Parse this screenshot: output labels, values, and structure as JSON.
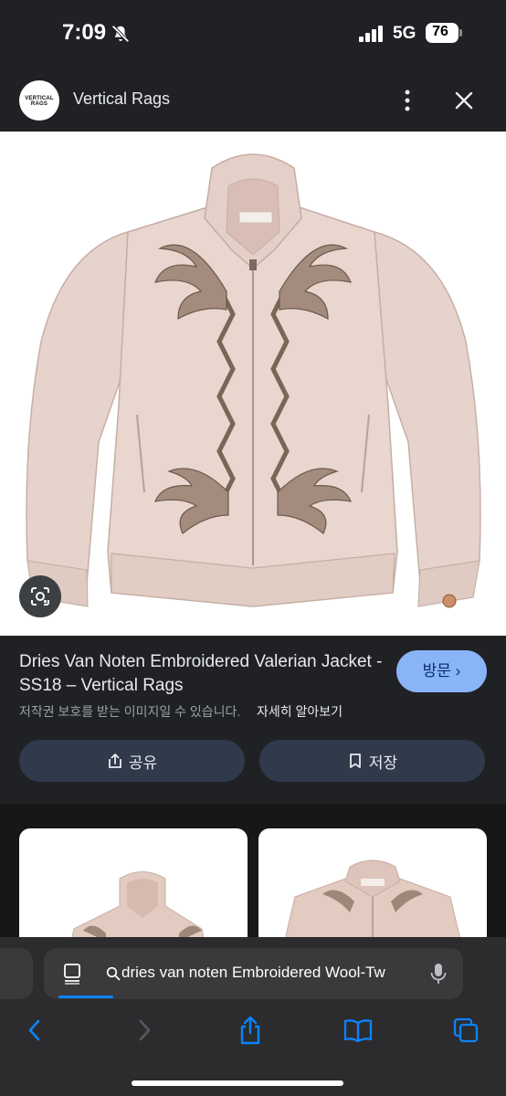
{
  "status": {
    "time": "7:09",
    "network": "5G",
    "battery": "76"
  },
  "header": {
    "site_name": "Vertical Rags",
    "logo_text": "VERTICAL RAGS"
  },
  "result": {
    "title": "Dries Van Noten Embroidered Valerian Jacket - SS18 – Vertical Rags",
    "visit_label": "방문",
    "copyright_note": "저작권 보호를 받는 이미지일 수 있습니다.",
    "learn_more": "자세히 알아보기",
    "share_label": "공유",
    "save_label": "저장"
  },
  "browser": {
    "address": "dries van noten Embroidered Wool-Tw"
  },
  "colors": {
    "accent": "#8ab4f8",
    "jacket": "#e4cfc8",
    "embroidery": "#7b6557"
  },
  "icons": [
    "bell-slash-icon",
    "signal-icon",
    "kebab-menu-icon",
    "close-icon",
    "google-lens-icon",
    "share-icon",
    "bookmark-icon",
    "reader-icon",
    "search-icon",
    "mic-icon",
    "back-icon",
    "forward-icon",
    "share-sheet-icon",
    "bookmarks-icon",
    "tabs-icon"
  ]
}
